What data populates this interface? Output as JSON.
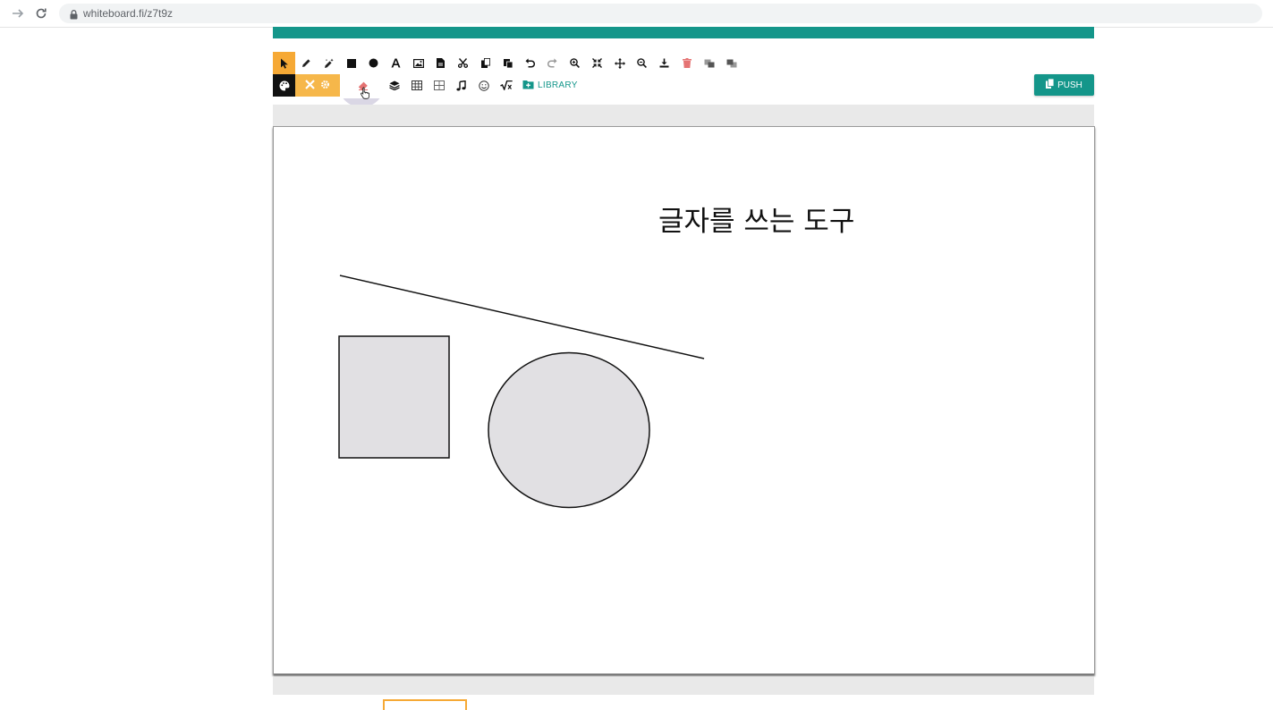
{
  "browser": {
    "url": "whiteboard.fi/z7t9z"
  },
  "toolbar": {
    "row1_tools": [
      {
        "icon": "pointer-icon",
        "active": true
      },
      {
        "icon": "pencil-icon"
      },
      {
        "icon": "magic-pencil-icon"
      },
      {
        "icon": "square-icon"
      },
      {
        "icon": "circle-icon"
      },
      {
        "icon": "text-icon"
      },
      {
        "icon": "image-icon"
      },
      {
        "icon": "pdf-icon"
      },
      {
        "icon": "scissors-icon"
      },
      {
        "icon": "copy-icon"
      },
      {
        "icon": "paste-icon"
      },
      {
        "icon": "undo-icon"
      },
      {
        "icon": "redo-icon"
      },
      {
        "icon": "zoom-in-icon"
      },
      {
        "icon": "fit-screen-icon"
      },
      {
        "icon": "move-icon"
      },
      {
        "icon": "zoom-out-icon"
      },
      {
        "icon": "download-icon"
      },
      {
        "icon": "trash-icon"
      },
      {
        "icon": "bring-forward-icon"
      },
      {
        "icon": "send-backward-icon"
      }
    ],
    "library_label": "LIBRARY",
    "push_label": "PUSH",
    "accent_color": "#14968a",
    "active_color": "#f6a935"
  },
  "canvas": {
    "text": "글자를 쓰는 도구",
    "shape_fill": "#e1e0e3"
  }
}
